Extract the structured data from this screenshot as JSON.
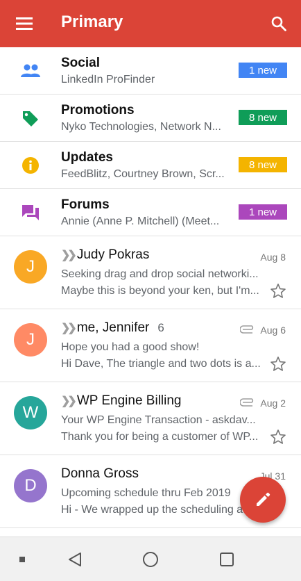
{
  "header": {
    "title": "Primary"
  },
  "categories": [
    {
      "title": "Social",
      "subtitle": "LinkedIn ProFinder",
      "badge": "1 new",
      "color": "#4285f4",
      "icon": "people-icon"
    },
    {
      "title": "Promotions",
      "subtitle": "Nyko Technologies, Network N...",
      "badge": "8 new",
      "color": "#0f9d58",
      "icon": "tag-icon"
    },
    {
      "title": "Updates",
      "subtitle": "FeedBlitz, Courtney Brown, Scr...",
      "badge": "8 new",
      "color": "#f4b400",
      "icon": "info-icon"
    },
    {
      "title": "Forums",
      "subtitle": "Annie (Anne P. Mitchell) (Meet...",
      "badge": "1 new",
      "color": "#ab47bc",
      "icon": "forum-icon"
    }
  ],
  "mails": [
    {
      "initial": "J",
      "avatar_color": "#f9a825",
      "sender": "Judy Pokras",
      "count": "",
      "date": "Aug 8",
      "attachment": false,
      "important": true,
      "subject": "Seeking drag and drop social networki...",
      "snippet": "Maybe this is beyond your ken, but I'm..."
    },
    {
      "initial": "J",
      "avatar_color": "#ff8a65",
      "sender": "me, Jennifer",
      "count": "6",
      "date": "Aug 6",
      "attachment": true,
      "important": true,
      "subject": "Hope you had a good show!",
      "snippet": "Hi Dave, The triangle and two dots is a..."
    },
    {
      "initial": "W",
      "avatar_color": "#26a69a",
      "sender": "WP Engine Billing",
      "count": "",
      "date": "Aug 2",
      "attachment": true,
      "important": true,
      "subject": "Your WP Engine Transaction - askdav...",
      "snippet": "Thank you for being a customer of WP..."
    },
    {
      "initial": "D",
      "avatar_color": "#9575cd",
      "sender": "Donna Gross",
      "count": "",
      "date": "Jul 31",
      "attachment": false,
      "important": false,
      "subject": "Upcoming schedule thru Feb 2019",
      "snippet": "Hi - We wrapped up the scheduling a..."
    }
  ],
  "colors": {
    "brand": "#db4437"
  },
  "icons": {
    "menu": "menu-icon",
    "search": "search-icon",
    "compose": "pencil-icon",
    "star": "star-outline-icon",
    "attachment": "paperclip-icon",
    "nav_recent": "square-small-icon",
    "nav_back": "triangle-back-icon",
    "nav_home": "circle-home-icon",
    "nav_overview": "square-overview-icon"
  }
}
